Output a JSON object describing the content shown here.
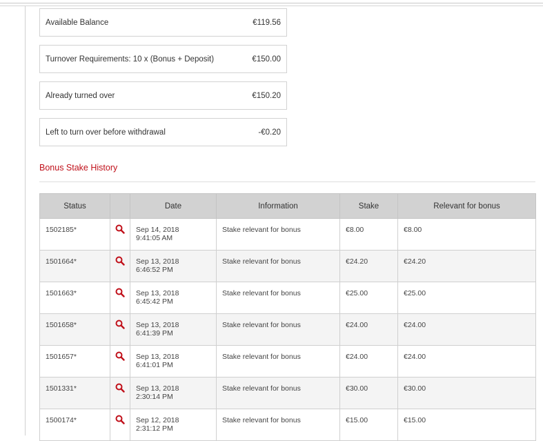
{
  "summary": [
    {
      "label": "Available Balance",
      "value": "€119.56"
    },
    {
      "label": "Turnover Requirements: 10 x (Bonus + Deposit)",
      "value": "€150.00"
    },
    {
      "label": "Already turned over",
      "value": "€150.20"
    },
    {
      "label": "Left to turn over before withdrawal",
      "value": "-€0.20"
    }
  ],
  "history": {
    "title": "Bonus Stake History",
    "columns": [
      "Status",
      "",
      "Date",
      "Information",
      "Stake",
      "Relevant for bonus"
    ],
    "icon": "search-icon",
    "accent": "#c0101a",
    "rows": [
      {
        "status": "1502185*",
        "date1": "Sep 14, 2018",
        "date2": "9:41:05 AM",
        "info": "Stake relevant for bonus",
        "stake": "€8.00",
        "relevant": "€8.00"
      },
      {
        "status": "1501664*",
        "date1": "Sep 13, 2018",
        "date2": "6:46:52 PM",
        "info": "Stake relevant for bonus",
        "stake": "€24.20",
        "relevant": "€24.20"
      },
      {
        "status": "1501663*",
        "date1": "Sep 13, 2018",
        "date2": "6:45:42 PM",
        "info": "Stake relevant for bonus",
        "stake": "€25.00",
        "relevant": "€25.00"
      },
      {
        "status": "1501658*",
        "date1": "Sep 13, 2018",
        "date2": "6:41:39 PM",
        "info": "Stake relevant for bonus",
        "stake": "€24.00",
        "relevant": "€24.00"
      },
      {
        "status": "1501657*",
        "date1": "Sep 13, 2018",
        "date2": "6:41:01 PM",
        "info": "Stake relevant for bonus",
        "stake": "€24.00",
        "relevant": "€24.00"
      },
      {
        "status": "1501331*",
        "date1": "Sep 13, 2018",
        "date2": "2:30:14 PM",
        "info": "Stake relevant for bonus",
        "stake": "€30.00",
        "relevant": "€30.00"
      },
      {
        "status": "1500174*",
        "date1": "Sep 12, 2018",
        "date2": "2:31:12 PM",
        "info": "Stake relevant for bonus",
        "stake": "€15.00",
        "relevant": "€15.00"
      }
    ]
  }
}
